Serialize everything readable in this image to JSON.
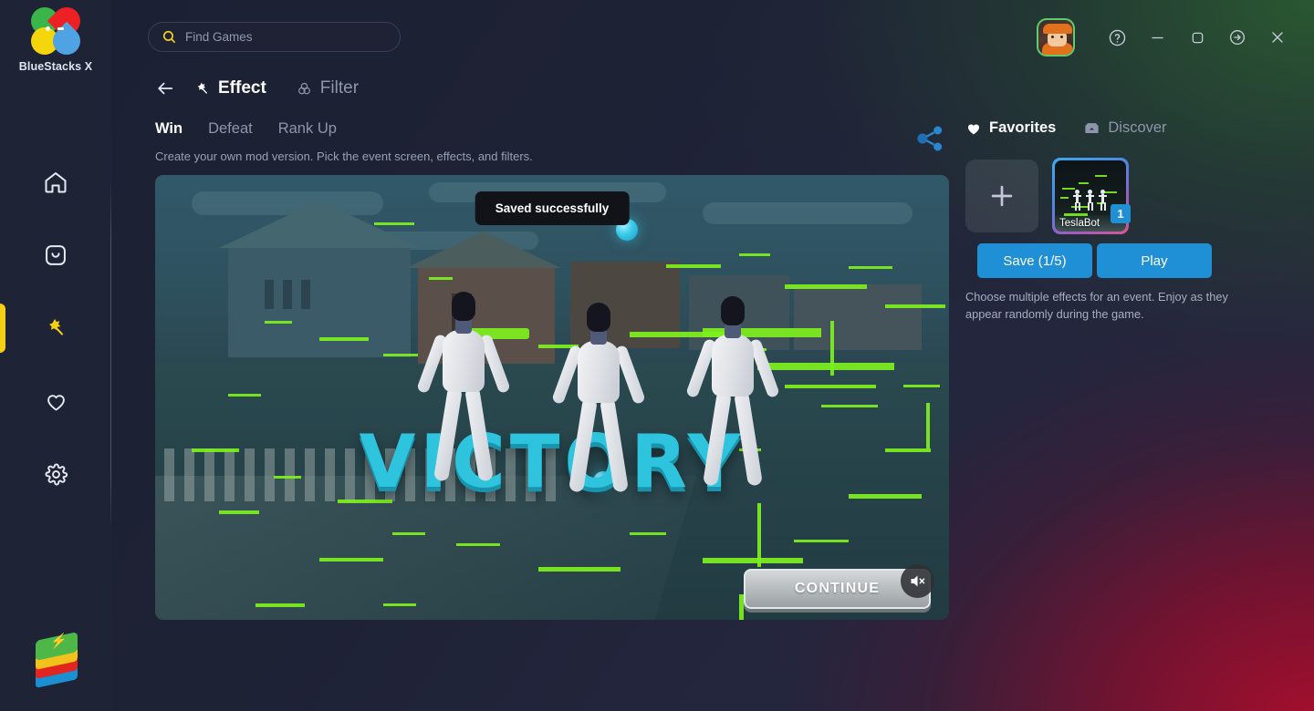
{
  "brand": {
    "name": "BlueStacks X",
    "logo_icon": "bluestacks-petals-logo"
  },
  "search": {
    "placeholder": "Find Games",
    "icon": "search-icon"
  },
  "sidebar": {
    "items": [
      {
        "icon": "home-icon",
        "name": "home",
        "active": false
      },
      {
        "icon": "app-drawer-icon",
        "name": "my-games",
        "active": false
      },
      {
        "icon": "magic-wand-icon",
        "name": "effects",
        "active": true
      },
      {
        "icon": "heart-icon",
        "name": "favorites",
        "active": false
      },
      {
        "icon": "gear-icon",
        "name": "settings",
        "active": false
      }
    ],
    "tray_logo_icon": "bluestacks-stack-logo"
  },
  "window_controls": {
    "avatar_icon": "user-avatar",
    "help_label": "?",
    "buttons": [
      {
        "name": "help",
        "icon": "question-circle-icon"
      },
      {
        "name": "minimize",
        "icon": "minimize-icon"
      },
      {
        "name": "maximize",
        "icon": "maximize-icon"
      },
      {
        "name": "exit-arrow",
        "icon": "arrow-right-circle-icon"
      },
      {
        "name": "close",
        "icon": "close-icon"
      }
    ]
  },
  "header": {
    "back_icon": "arrow-left-icon",
    "effect_tab": {
      "label": "Effect",
      "icon": "magic-wand-icon",
      "active": true
    },
    "filter_tab": {
      "label": "Filter",
      "icon": "three-circles-icon",
      "active": false
    }
  },
  "mode_tabs": [
    {
      "label": "Win",
      "active": true
    },
    {
      "label": "Defeat",
      "active": false
    },
    {
      "label": "Rank Up",
      "active": false
    }
  ],
  "subtitle": "Create your own mod version. Pick the event screen, effects, and filters.",
  "preview": {
    "toast": "Saved successfully",
    "victory_text": "VICTORY",
    "continue_label": "CONTINUE",
    "mute_icon": "speaker-muted-icon"
  },
  "right_panel": {
    "share_icon": "share-nodes-icon",
    "tabs": [
      {
        "label": "Favorites",
        "icon": "heart-filled-icon",
        "active": true
      },
      {
        "label": "Discover",
        "icon": "store-icon",
        "active": false
      }
    ],
    "add_tile_icon": "plus-icon",
    "thumbnail": {
      "label": "TeslaBot",
      "badge": "1"
    },
    "save_label": "Save (1/5)",
    "play_label": "Play",
    "note": "Choose multiple effects for an event. Enjoy as they appear randomly during the game."
  },
  "colors": {
    "accent_blue": "#1f8fd6",
    "accent_yellow": "#f4cf18",
    "victory_cyan": "#2ec4dd",
    "glitch_green": "#7ef01e"
  }
}
